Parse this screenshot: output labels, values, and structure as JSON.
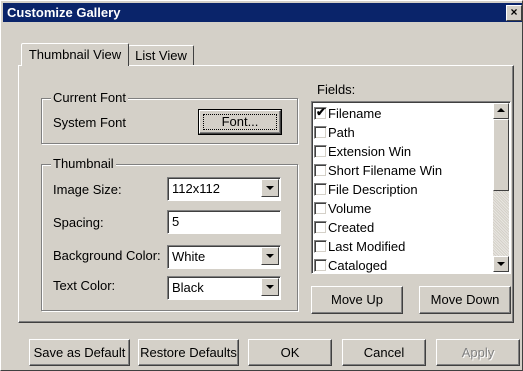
{
  "window": {
    "title": "Customize Gallery",
    "close_glyph": "×"
  },
  "tabs": [
    {
      "label": "Thumbnail View",
      "active": true
    },
    {
      "label": "List View",
      "active": false
    }
  ],
  "current_font": {
    "group_label": "Current Font",
    "font_name": "System Font",
    "font_button": "Font..."
  },
  "thumbnail": {
    "group_label": "Thumbnail",
    "image_size_label": "Image Size:",
    "image_size_value": "112x112",
    "spacing_label": "Spacing:",
    "spacing_value": "5",
    "bg_color_label": "Background Color:",
    "bg_color_value": "White",
    "text_color_label": "Text Color:",
    "text_color_value": "Black"
  },
  "fields": {
    "label": "Fields:",
    "items": [
      {
        "label": "Filename",
        "checked": true
      },
      {
        "label": "Path",
        "checked": false
      },
      {
        "label": "Extension Win",
        "checked": false
      },
      {
        "label": "Short Filename Win",
        "checked": false
      },
      {
        "label": "File Description",
        "checked": false
      },
      {
        "label": "Volume",
        "checked": false
      },
      {
        "label": "Created",
        "checked": false
      },
      {
        "label": "Last Modified",
        "checked": false
      },
      {
        "label": "Cataloged",
        "checked": false
      }
    ],
    "check_glyph": "✔",
    "move_up": "Move Up",
    "move_down": "Move Down"
  },
  "footer": {
    "save_default": "Save as Default",
    "restore_defaults": "Restore Defaults",
    "ok": "OK",
    "cancel": "Cancel",
    "apply": "Apply"
  }
}
